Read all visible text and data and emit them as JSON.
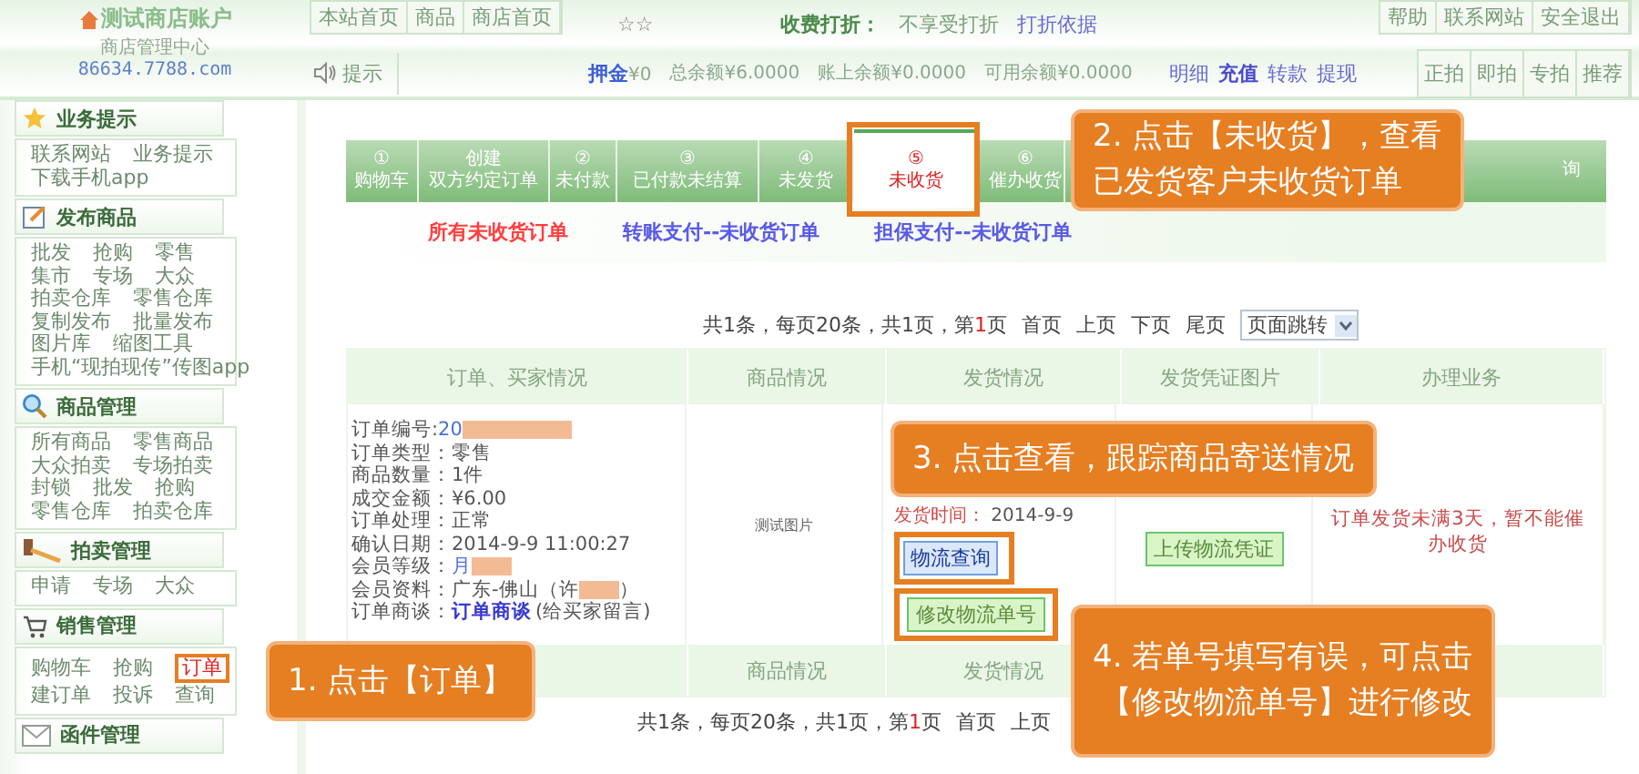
{
  "logo": {
    "title": "测试商店账户",
    "subtitle": "商店管理中心",
    "domain": "86634.7788.com"
  },
  "top_nav": [
    "本站首页",
    "商品",
    "商店首页"
  ],
  "stars": "☆☆",
  "discount": {
    "label": "收费打折：",
    "value": "不享受打折",
    "link": "打折依据"
  },
  "top_right": [
    "帮助",
    "联系网站",
    "安全退出"
  ],
  "notice": "提示",
  "balances": [
    {
      "label": "押金",
      "value": "¥0",
      "bold": true
    },
    {
      "label": "总余额",
      "value": "¥6.0000",
      "bold": false
    },
    {
      "label": "账上余额",
      "value": "¥0.0000",
      "bold": false
    },
    {
      "label": "可用余额",
      "value": "¥0.0000",
      "bold": false
    }
  ],
  "account_links": [
    {
      "label": "明细",
      "bold": false
    },
    {
      "label": "充值",
      "bold": true
    },
    {
      "label": "转款",
      "bold": false
    },
    {
      "label": "提现",
      "bold": false
    }
  ],
  "auction_links": [
    "正拍",
    "即拍",
    "专拍",
    "推荐"
  ],
  "sidebar": [
    {
      "title": "业务提示",
      "kind": "star",
      "rows": [
        [
          {
            "label": "联系网站",
            "selected": false
          },
          {
            "label": "业务提示",
            "selected": false
          }
        ],
        [
          {
            "label": "下载手机app",
            "selected": false
          }
        ]
      ]
    },
    {
      "title": "发布商品",
      "kind": "note",
      "rows": [
        [
          {
            "label": "批发",
            "selected": false
          },
          {
            "label": "抢购",
            "selected": false
          },
          {
            "label": "零售",
            "selected": false
          }
        ],
        [
          {
            "label": "集市",
            "selected": false
          },
          {
            "label": "专场",
            "selected": false
          },
          {
            "label": "大众",
            "selected": false
          }
        ],
        [
          {
            "label": "拍卖仓库",
            "selected": false
          },
          {
            "label": "零售仓库",
            "selected": false
          }
        ],
        [
          {
            "label": "复制发布",
            "selected": false
          },
          {
            "label": "批量发布",
            "selected": false
          }
        ],
        [
          {
            "label": "图片库",
            "selected": false
          },
          {
            "label": "缩图工具",
            "selected": false
          }
        ],
        [
          {
            "label": "手机“现拍现传”传图app",
            "selected": false
          }
        ]
      ]
    },
    {
      "title": "商品管理",
      "kind": "search",
      "rows": [
        [
          {
            "label": "所有商品",
            "selected": false
          },
          {
            "label": "零售商品",
            "selected": false
          }
        ],
        [
          {
            "label": "大众拍卖",
            "selected": false
          },
          {
            "label": "专场拍卖",
            "selected": false
          }
        ],
        [
          {
            "label": "封锁",
            "selected": false
          },
          {
            "label": "批发",
            "selected": false
          },
          {
            "label": "抢购",
            "selected": false
          }
        ],
        [
          {
            "label": "零售仓库",
            "selected": false
          },
          {
            "label": "拍卖仓库",
            "selected": false
          }
        ]
      ]
    },
    {
      "title": "拍卖管理",
      "kind": "hammer",
      "rows": [
        [
          {
            "label": "申请",
            "selected": false
          },
          {
            "label": "专场",
            "selected": false
          },
          {
            "label": "大众",
            "selected": false
          }
        ]
      ]
    },
    {
      "title": "销售管理",
      "kind": "cart",
      "rows": [
        [
          {
            "label": "购物车",
            "selected": false
          },
          {
            "label": "抢购",
            "selected": false
          },
          {
            "label": "订单",
            "selected": true
          }
        ],
        [
          {
            "label": "建订单",
            "selected": false
          },
          {
            "label": "投诉",
            "selected": false
          },
          {
            "label": "查询",
            "selected": false
          }
        ]
      ]
    },
    {
      "title": "函件管理",
      "kind": "mail"
    }
  ],
  "tabs": [
    {
      "number": "①",
      "label": "购物车",
      "selected": false
    },
    {
      "number": "创建",
      "label": "双方约定订单",
      "selected": false
    },
    {
      "number": "②",
      "label": "未付款",
      "selected": false
    },
    {
      "number": "③",
      "label": "已付款未结算",
      "selected": false
    },
    {
      "number": "④",
      "label": "未发货",
      "selected": false
    },
    {
      "number": "⑤",
      "label": "未收货",
      "selected": true
    },
    {
      "number": "⑥",
      "label": "催办收货",
      "selected": false
    },
    {
      "label": "询",
      "selected": false
    }
  ],
  "sub_links": [
    {
      "label": "所有未收货订单",
      "color": "#ff4040"
    },
    {
      "label": "转账支付--未收货订单",
      "color": "#5a5ae6"
    },
    {
      "label": "担保支付--未收货订单",
      "color": "#5a5ae6"
    }
  ],
  "pagination_top": {
    "before": "共1条，每页20条，共1页，第",
    "current": "1",
    "after": "页",
    "links": [
      "首页",
      "上页",
      "下页",
      "尾页"
    ],
    "jump": "页面跳转"
  },
  "table": {
    "columns": [
      "订单、买家情况",
      "商品情况",
      "发货情况",
      "发货凭证图片",
      "办理业务"
    ],
    "order": [
      {
        "label": "订单编号:",
        "value": "20",
        "kind": "link",
        "redacted": true
      },
      {
        "label": "订单类型：",
        "value": "零售",
        "kind": "plain",
        "redacted": false
      },
      {
        "label": "商品数量：",
        "value": "1件",
        "kind": "plain",
        "redacted": false
      },
      {
        "label": "成交金额：",
        "value": "¥6.00",
        "kind": "plain",
        "redacted": false
      },
      {
        "label": "订单处理：",
        "value": "正常",
        "kind": "plain",
        "redacted": false
      },
      {
        "label": "确认日期：",
        "value": "2014-9-9 11:00:27",
        "kind": "plain",
        "redacted": false
      },
      {
        "label": "会员等级：",
        "value": "月",
        "kind": "link",
        "redacted": true
      },
      {
        "label": "会员资料：",
        "value": "广东-佛山（许",
        "kind": "plain",
        "redacted": true,
        "suffix": "）"
      },
      {
        "label": "订单商谈：",
        "value": "订单商谈",
        "kind": "talk",
        "redacted": false,
        "suffix": "(给买家留言)"
      }
    ],
    "product_image": "测试图片",
    "ship_label": "发货时间：",
    "ship_date": "2014-9-9",
    "track_button": "物流查询",
    "edit_button": "修改物流单号",
    "upload_button": "上传物流凭证",
    "action_note": "订单发货未满3天，暂不能催办收货",
    "footer_columns": [
      "商品情况",
      "发货情况"
    ]
  },
  "pagination_bottom": {
    "before": "共1条，每页20条，共1页，第",
    "current": "1",
    "after": "页",
    "links": [
      "首页",
      "上页"
    ]
  },
  "callouts": [
    {
      "lines": [
        "1. 点击【订单】"
      ]
    },
    {
      "lines": [
        "2. 点击【未收货】，查看",
        "已发货客户未收货订单"
      ]
    },
    {
      "lines": [
        "3. 点击查看，跟踪商品寄送情况"
      ]
    },
    {
      "lines": [
        "4. 若单号填写有误，可点击",
        "【修改物流单号】进行修改"
      ]
    }
  ]
}
